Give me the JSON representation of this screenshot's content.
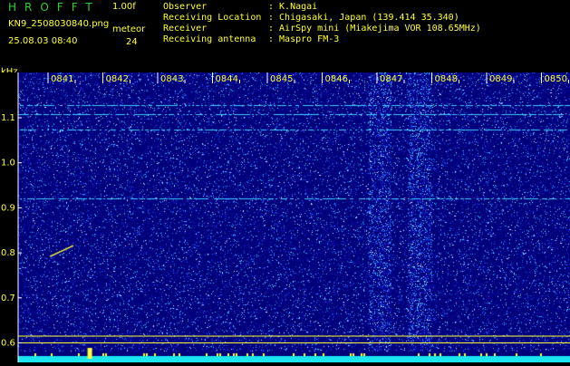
{
  "header": {
    "app_title": "HROFFT",
    "version": "1.00f",
    "filename": "KN9_2508030840.png",
    "datetime": "25.08.03 08:40",
    "meteor_label": "meteor",
    "meteor_count": "24"
  },
  "meta": [
    {
      "label": "Observer",
      "value": ": K.Nagai"
    },
    {
      "label": "Receiving Location",
      "value": ": Chigasaki, Japan (139.414 35.340)"
    },
    {
      "label": "Receiver",
      "value": ": AirSpy mini (Miakejima VOR 108.65MHz)"
    },
    {
      "label": "Receiving antenna",
      "value": ": Maspro FM-3"
    }
  ],
  "chart_data": {
    "type": "heatmap",
    "ylabel": "kHz",
    "ylim": [
      0.58,
      1.19
    ],
    "x_ticks": [
      "0841",
      "0842",
      "0843",
      "0844",
      "0845",
      "0846",
      "0847",
      "0848",
      "0849",
      "0850"
    ],
    "y_ticks": [
      "1.1",
      "1.0",
      "0.9",
      "0.8",
      "0.7",
      "0.6"
    ],
    "x_range": [
      "08:40",
      "08:50"
    ],
    "colors": {
      "background": "#00007a",
      "noise_low": "#1414d0",
      "noise_mid": "#2a6bff",
      "noise_high": "#3fd0ff",
      "hot": "#ffffff",
      "carrier": "#19e6f0",
      "marker": "#ffff33",
      "scale_text": "#ffff33"
    },
    "horizontal_lines_khz": [
      1.128,
      1.108,
      1.073,
      0.92
    ],
    "guide_lines_khz": [
      0.615,
      0.6
    ],
    "bright_band_minutes": [
      [
        6.85,
        7.25
      ],
      [
        7.55,
        8.0
      ]
    ],
    "meteor_echo": {
      "t_minutes": 1.1,
      "khz": 0.8
    }
  }
}
